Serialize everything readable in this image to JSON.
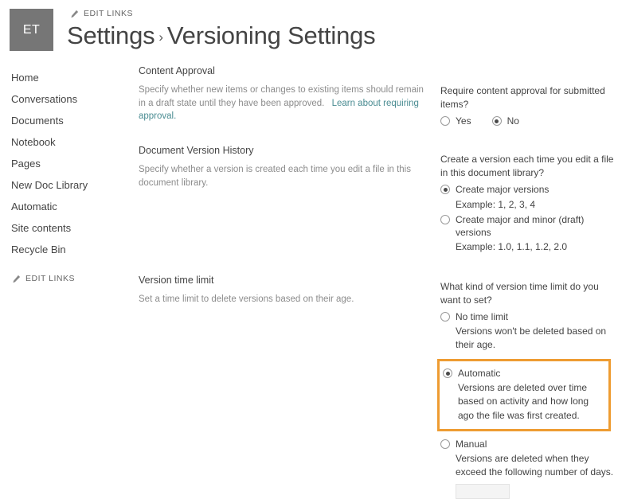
{
  "header": {
    "site_initials": "ET",
    "edit_links_label": "EDIT LINKS",
    "title_first": "Settings",
    "title_separator": "›",
    "title_second": "Versioning Settings"
  },
  "sidebar": {
    "items": [
      {
        "label": "Home"
      },
      {
        "label": "Conversations"
      },
      {
        "label": "Documents"
      },
      {
        "label": "Notebook"
      },
      {
        "label": "Pages"
      },
      {
        "label": "New Doc Library"
      },
      {
        "label": "Automatic"
      },
      {
        "label": "Site contents"
      },
      {
        "label": "Recycle Bin"
      }
    ],
    "edit_links_label": "EDIT LINKS"
  },
  "sections": {
    "content_approval": {
      "title": "Content Approval",
      "description": "Specify whether new items or changes to existing items should remain in a draft state until they have been approved.",
      "link_text": "Learn about requiring approval.",
      "question": "Require content approval for submitted items?",
      "option_yes": "Yes",
      "option_no": "No",
      "selected": "No"
    },
    "document_version_history": {
      "title": "Document Version History",
      "description": "Specify whether a version is created each time you edit a file in this document library.",
      "question": "Create a version each time you edit a file in this document library?",
      "option_major_label": "Create major versions",
      "option_major_example": "Example: 1, 2, 3, 4",
      "option_major_minor_label": "Create major and minor (draft) versions",
      "option_major_minor_example": "Example: 1.0, 1.1, 1.2, 2.0",
      "selected": "Create major versions"
    },
    "version_time_limit": {
      "title": "Version time limit",
      "description": "Set a time limit to delete versions based on their age.",
      "question": "What kind of version time limit do you want to set?",
      "option_none_label": "No time limit",
      "option_none_desc": "Versions won't be deleted based on their age.",
      "option_automatic_label": "Automatic",
      "option_automatic_desc": "Versions are deleted over time based on activity and how long ago the file was first created.",
      "option_manual_label": "Manual",
      "option_manual_desc": "Versions are deleted when they exceed the following number of days.",
      "days_input_value": "",
      "selected": "Automatic"
    }
  },
  "colors": {
    "highlight_border": "#ee9c32",
    "site_tile_bg": "#767676",
    "link": "#4a8c92"
  }
}
